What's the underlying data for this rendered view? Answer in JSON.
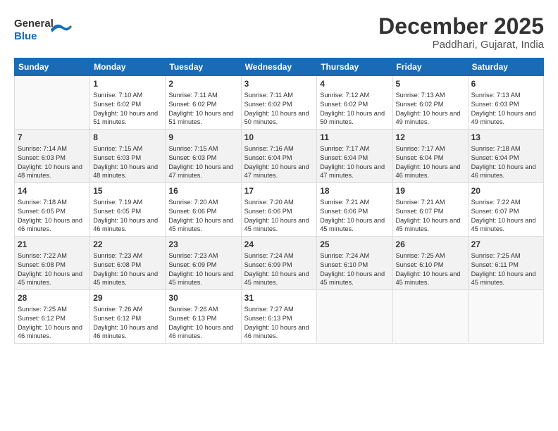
{
  "logo": {
    "general": "General",
    "blue": "Blue"
  },
  "title": "December 2025",
  "location": "Paddhari, Gujarat, India",
  "days_of_week": [
    "Sunday",
    "Monday",
    "Tuesday",
    "Wednesday",
    "Thursday",
    "Friday",
    "Saturday"
  ],
  "weeks": [
    [
      {
        "num": "",
        "sunrise": "",
        "sunset": "",
        "daylight": ""
      },
      {
        "num": "1",
        "sunrise": "Sunrise: 7:10 AM",
        "sunset": "Sunset: 6:02 PM",
        "daylight": "Daylight: 10 hours and 51 minutes."
      },
      {
        "num": "2",
        "sunrise": "Sunrise: 7:11 AM",
        "sunset": "Sunset: 6:02 PM",
        "daylight": "Daylight: 10 hours and 51 minutes."
      },
      {
        "num": "3",
        "sunrise": "Sunrise: 7:11 AM",
        "sunset": "Sunset: 6:02 PM",
        "daylight": "Daylight: 10 hours and 50 minutes."
      },
      {
        "num": "4",
        "sunrise": "Sunrise: 7:12 AM",
        "sunset": "Sunset: 6:02 PM",
        "daylight": "Daylight: 10 hours and 50 minutes."
      },
      {
        "num": "5",
        "sunrise": "Sunrise: 7:13 AM",
        "sunset": "Sunset: 6:02 PM",
        "daylight": "Daylight: 10 hours and 49 minutes."
      },
      {
        "num": "6",
        "sunrise": "Sunrise: 7:13 AM",
        "sunset": "Sunset: 6:03 PM",
        "daylight": "Daylight: 10 hours and 49 minutes."
      }
    ],
    [
      {
        "num": "7",
        "sunrise": "Sunrise: 7:14 AM",
        "sunset": "Sunset: 6:03 PM",
        "daylight": "Daylight: 10 hours and 48 minutes."
      },
      {
        "num": "8",
        "sunrise": "Sunrise: 7:15 AM",
        "sunset": "Sunset: 6:03 PM",
        "daylight": "Daylight: 10 hours and 48 minutes."
      },
      {
        "num": "9",
        "sunrise": "Sunrise: 7:15 AM",
        "sunset": "Sunset: 6:03 PM",
        "daylight": "Daylight: 10 hours and 47 minutes."
      },
      {
        "num": "10",
        "sunrise": "Sunrise: 7:16 AM",
        "sunset": "Sunset: 6:04 PM",
        "daylight": "Daylight: 10 hours and 47 minutes."
      },
      {
        "num": "11",
        "sunrise": "Sunrise: 7:17 AM",
        "sunset": "Sunset: 6:04 PM",
        "daylight": "Daylight: 10 hours and 47 minutes."
      },
      {
        "num": "12",
        "sunrise": "Sunrise: 7:17 AM",
        "sunset": "Sunset: 6:04 PM",
        "daylight": "Daylight: 10 hours and 46 minutes."
      },
      {
        "num": "13",
        "sunrise": "Sunrise: 7:18 AM",
        "sunset": "Sunset: 6:04 PM",
        "daylight": "Daylight: 10 hours and 46 minutes."
      }
    ],
    [
      {
        "num": "14",
        "sunrise": "Sunrise: 7:18 AM",
        "sunset": "Sunset: 6:05 PM",
        "daylight": "Daylight: 10 hours and 46 minutes."
      },
      {
        "num": "15",
        "sunrise": "Sunrise: 7:19 AM",
        "sunset": "Sunset: 6:05 PM",
        "daylight": "Daylight: 10 hours and 46 minutes."
      },
      {
        "num": "16",
        "sunrise": "Sunrise: 7:20 AM",
        "sunset": "Sunset: 6:06 PM",
        "daylight": "Daylight: 10 hours and 45 minutes."
      },
      {
        "num": "17",
        "sunrise": "Sunrise: 7:20 AM",
        "sunset": "Sunset: 6:06 PM",
        "daylight": "Daylight: 10 hours and 45 minutes."
      },
      {
        "num": "18",
        "sunrise": "Sunrise: 7:21 AM",
        "sunset": "Sunset: 6:06 PM",
        "daylight": "Daylight: 10 hours and 45 minutes."
      },
      {
        "num": "19",
        "sunrise": "Sunrise: 7:21 AM",
        "sunset": "Sunset: 6:07 PM",
        "daylight": "Daylight: 10 hours and 45 minutes."
      },
      {
        "num": "20",
        "sunrise": "Sunrise: 7:22 AM",
        "sunset": "Sunset: 6:07 PM",
        "daylight": "Daylight: 10 hours and 45 minutes."
      }
    ],
    [
      {
        "num": "21",
        "sunrise": "Sunrise: 7:22 AM",
        "sunset": "Sunset: 6:08 PM",
        "daylight": "Daylight: 10 hours and 45 minutes."
      },
      {
        "num": "22",
        "sunrise": "Sunrise: 7:23 AM",
        "sunset": "Sunset: 6:08 PM",
        "daylight": "Daylight: 10 hours and 45 minutes."
      },
      {
        "num": "23",
        "sunrise": "Sunrise: 7:23 AM",
        "sunset": "Sunset: 6:09 PM",
        "daylight": "Daylight: 10 hours and 45 minutes."
      },
      {
        "num": "24",
        "sunrise": "Sunrise: 7:24 AM",
        "sunset": "Sunset: 6:09 PM",
        "daylight": "Daylight: 10 hours and 45 minutes."
      },
      {
        "num": "25",
        "sunrise": "Sunrise: 7:24 AM",
        "sunset": "Sunset: 6:10 PM",
        "daylight": "Daylight: 10 hours and 45 minutes."
      },
      {
        "num": "26",
        "sunrise": "Sunrise: 7:25 AM",
        "sunset": "Sunset: 6:10 PM",
        "daylight": "Daylight: 10 hours and 45 minutes."
      },
      {
        "num": "27",
        "sunrise": "Sunrise: 7:25 AM",
        "sunset": "Sunset: 6:11 PM",
        "daylight": "Daylight: 10 hours and 45 minutes."
      }
    ],
    [
      {
        "num": "28",
        "sunrise": "Sunrise: 7:25 AM",
        "sunset": "Sunset: 6:12 PM",
        "daylight": "Daylight: 10 hours and 46 minutes."
      },
      {
        "num": "29",
        "sunrise": "Sunrise: 7:26 AM",
        "sunset": "Sunset: 6:12 PM",
        "daylight": "Daylight: 10 hours and 46 minutes."
      },
      {
        "num": "30",
        "sunrise": "Sunrise: 7:26 AM",
        "sunset": "Sunset: 6:13 PM",
        "daylight": "Daylight: 10 hours and 46 minutes."
      },
      {
        "num": "31",
        "sunrise": "Sunrise: 7:27 AM",
        "sunset": "Sunset: 6:13 PM",
        "daylight": "Daylight: 10 hours and 46 minutes."
      },
      {
        "num": "",
        "sunrise": "",
        "sunset": "",
        "daylight": ""
      },
      {
        "num": "",
        "sunrise": "",
        "sunset": "",
        "daylight": ""
      },
      {
        "num": "",
        "sunrise": "",
        "sunset": "",
        "daylight": ""
      }
    ]
  ]
}
